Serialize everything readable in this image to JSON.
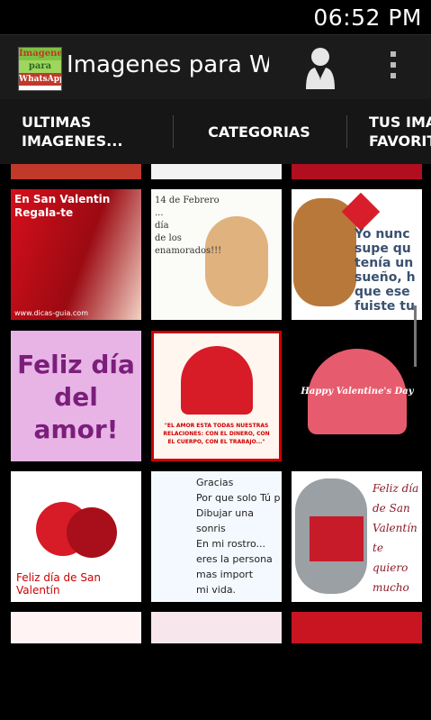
{
  "status_bar": {
    "time": "06:52 PM"
  },
  "action_bar": {
    "logo_lines": [
      "Imagenes",
      "para",
      "WhatsApp"
    ],
    "title": "Imagenes para Wh",
    "person_icon": "person-icon",
    "overflow_icon": "overflow-menu-icon"
  },
  "tabs": [
    {
      "label": "ULTIMAS\nIMAGENES...",
      "selected": true
    },
    {
      "label": "CATEGORIAS",
      "selected": false
    },
    {
      "label": "TUS IMA\nFAVORIT",
      "selected": false
    }
  ],
  "colors": {
    "accent": "#33b5e5",
    "bar": "#1b1b1b",
    "tabs_bg": "#161616"
  },
  "thumbnails": [
    {
      "text": "En San Valentin\nRegala-te",
      "footer": "www.dicas-guia.com"
    },
    {
      "text": "14 de Febrero\n...\ndía\nde los\nenamorados!!!"
    },
    {
      "text": "Yo nunc\nsupe qu\ntenía un\nsueño, h\nque ese\nfuiste tu"
    },
    {
      "text": "Feliz día\ndel\namor!"
    },
    {
      "text": "\"EL AMOR ESTA TODAS NUESTRAS RELACIONES: CON EL DINERO, CON EL CUERPO, CON EL TRABAJO...\""
    },
    {
      "text": "Happy Valentine's Day"
    },
    {
      "text": "Feliz día de San Valentín"
    },
    {
      "text": "Gracias\nPor que solo Tú p\nDibujar una sonris\nEn mi rostro...\neres la persona mas import\nmi vida."
    },
    {
      "text": "Feliz día\nde San\nValentín\nte quiero\nmucho"
    }
  ]
}
